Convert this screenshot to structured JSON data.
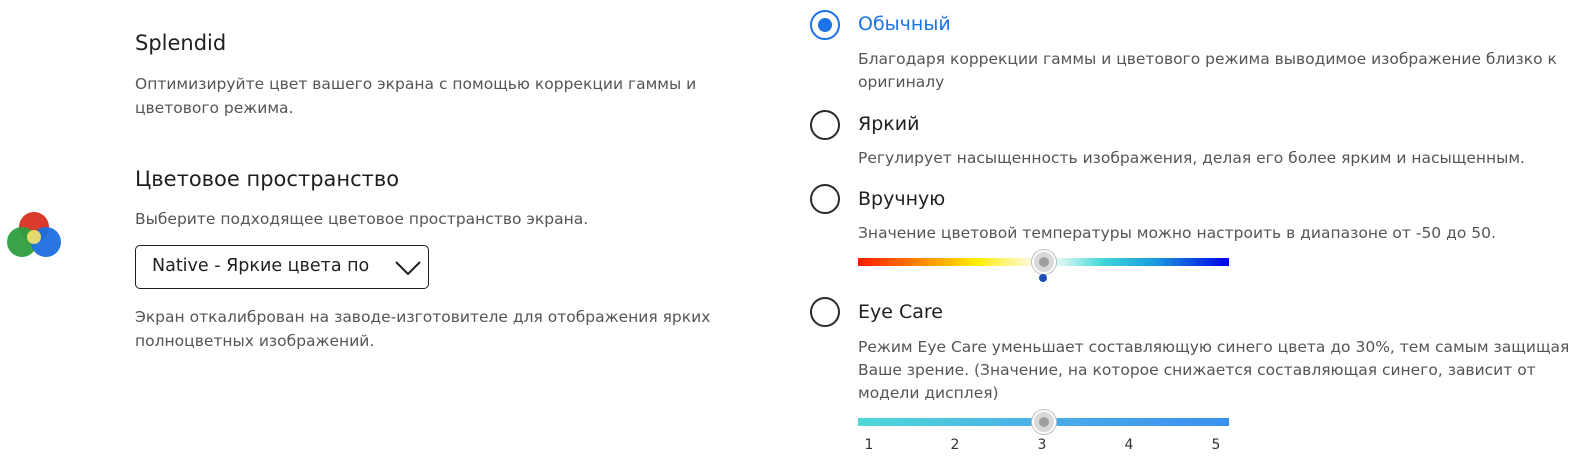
{
  "left": {
    "splendid_title": "Splendid",
    "splendid_desc_line1": "Оптимизируйте цвет вашего экрана с помощью коррекции гаммы и",
    "splendid_desc_line2": "цветового режима.",
    "color_space_title": "Цветовое пространство",
    "color_space_desc": "Выберите подходящее цветовое пространство экрана.",
    "color_space_select": {
      "value": "Native - Яркие цвета по"
    },
    "color_space_note_line1": "Экран откалиброван на заводе-изготовителе для отображения ярких",
    "color_space_note_line2": "полноцветных изображений."
  },
  "modes": {
    "selected": "normal",
    "normal": {
      "label": "Обычный",
      "desc_line1": "Благодаря коррекции гаммы и цветового режима выводимое изображение близко к",
      "desc_line2": "оригиналу"
    },
    "vivid": {
      "label": "Яркий",
      "desc": "Регулирует насыщенность изображения, делая его более ярким и насыщенным."
    },
    "manual": {
      "label": "Вручную",
      "desc": "Значение цветовой температуры можно настроить в диапазоне от -50 до 50.",
      "slider": {
        "min": -50,
        "max": 50,
        "value": 0
      }
    },
    "eye_care": {
      "label": "Eye Care",
      "desc_line1": "Режим Eye Care уменьшает составляющую синего цвета до 30%, тем самым защищая",
      "desc_line2": "Ваше зрение. (Значение, на которое снижается составляющая синего, зависит от",
      "desc_line3": "модели дисплея)",
      "slider": {
        "value": 3,
        "ticks": [
          "1",
          "2",
          "3",
          "4",
          "5"
        ]
      }
    }
  },
  "colors": {
    "accent": "#1a73e8",
    "text_secondary": "#555555"
  },
  "icons": {
    "app": "color-circles-icon",
    "dropdown": "chevron-down-icon"
  }
}
